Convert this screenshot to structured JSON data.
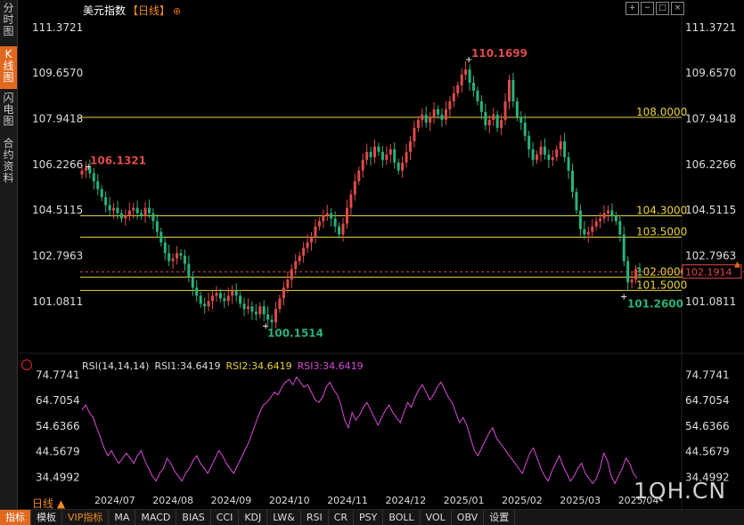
{
  "sidebar": {
    "tabs": [
      {
        "label": "分时图",
        "active": false
      },
      {
        "label": "K线图",
        "active": true
      },
      {
        "label": "闪电图",
        "active": false
      },
      {
        "label": "合约资料",
        "active": false
      }
    ]
  },
  "header": {
    "instrument": "美元指数",
    "period": "【日线】",
    "settings_icon": "gear-icon"
  },
  "toolbar_icons": [
    "zoom-in-icon",
    "zoom-out-icon",
    "maximize-icon",
    "close-icon"
  ],
  "period_label": "日线 ▲",
  "watermark": "1QH.CN",
  "colors": {
    "up": "#e04a4a",
    "down": "#29b27a",
    "level": "#e8d23a",
    "rsi": "#d94ad9",
    "current_price_tag": "#e04a4a",
    "accent": "#e2681f"
  },
  "rsi_legend": {
    "params": "RSI(14,14,14)",
    "rsi1": "RSI1:34.6419",
    "rsi2": "RSI2:34.6419",
    "rsi3": "RSI3:34.6419"
  },
  "bottom_tabs": [
    {
      "label": "指标",
      "active": true
    },
    {
      "label": "模板"
    },
    {
      "label": "VIP指标",
      "vip": true
    },
    {
      "label": "MA"
    },
    {
      "label": "MACD"
    },
    {
      "label": "BIAS"
    },
    {
      "label": "CCI"
    },
    {
      "label": "KDJ"
    },
    {
      "label": "LW&"
    },
    {
      "label": "RSI"
    },
    {
      "label": "CR"
    },
    {
      "label": "PSY"
    },
    {
      "label": "BOLL"
    },
    {
      "label": "VOL"
    },
    {
      "label": "OBV"
    },
    {
      "label": "设置"
    }
  ],
  "chart_data": [
    {
      "type": "candlestick",
      "x_labels": [
        "2024/07",
        "2024/08",
        "2024/09",
        "2024/10",
        "2024/11",
        "2024/12",
        "2025/01",
        "2025/02",
        "2025/03",
        "2025/04"
      ],
      "y_ticks": [
        "111.3721",
        "109.6570",
        "107.9418",
        "106.2266",
        "104.5115",
        "102.7963",
        "101.0811"
      ],
      "ylim": [
        99.54,
        111.87
      ],
      "horizontal_levels": [
        {
          "value": 108.0,
          "label": "108.0000"
        },
        {
          "value": 104.3,
          "label": "104.3000"
        },
        {
          "value": 103.5,
          "label": "103.5000"
        },
        {
          "value": 102.0,
          "label": "102.0000"
        },
        {
          "value": 101.5,
          "label": "101.5000"
        }
      ],
      "current_price": {
        "value": 102.1914,
        "label": "102.1914"
      },
      "annotations": [
        {
          "label": "106.1321",
          "value": 106.1321,
          "kind": "high"
        },
        {
          "label": "110.1699",
          "value": 110.1699,
          "kind": "high"
        },
        {
          "label": "100.1514",
          "value": 100.1514,
          "kind": "low"
        },
        {
          "label": "101.2600",
          "value": 101.26,
          "kind": "low"
        }
      ],
      "close_path": [
        106.0,
        106.1,
        105.9,
        105.6,
        105.3,
        105.0,
        104.7,
        104.5,
        104.6,
        104.4,
        104.2,
        104.3,
        104.5,
        104.6,
        104.4,
        104.3,
        104.6,
        104.4,
        104.1,
        103.7,
        103.3,
        102.9,
        102.6,
        102.7,
        102.9,
        102.8,
        102.5,
        102.0,
        101.6,
        101.3,
        101.0,
        100.9,
        101.1,
        101.3,
        101.4,
        101.2,
        101.1,
        101.3,
        101.5,
        101.3,
        101.0,
        100.8,
        100.9,
        100.7,
        100.6,
        100.9,
        100.6,
        100.4,
        100.3,
        100.8,
        101.2,
        101.6,
        101.9,
        102.3,
        102.6,
        102.8,
        103.1,
        103.3,
        103.5,
        103.9,
        104.1,
        104.3,
        104.4,
        104.2,
        103.9,
        103.6,
        104.0,
        104.6,
        105.1,
        105.6,
        106.0,
        106.4,
        106.7,
        106.5,
        106.9,
        106.7,
        106.4,
        106.6,
        106.8,
        106.3,
        106.0,
        106.3,
        106.7,
        107.1,
        107.6,
        107.9,
        108.1,
        107.8,
        108.0,
        108.3,
        108.1,
        107.9,
        108.3,
        108.6,
        108.9,
        109.2,
        109.6,
        109.8,
        109.3,
        109.0,
        108.6,
        108.2,
        107.7,
        107.9,
        108.1,
        107.6,
        107.9,
        108.6,
        109.4,
        108.6,
        108.0,
        107.8,
        107.3,
        106.8,
        106.4,
        106.6,
        106.9,
        106.6,
        106.4,
        106.5,
        106.8,
        107.1,
        106.5,
        106.0,
        105.2,
        104.5,
        103.8,
        103.6,
        103.7,
        103.9,
        104.1,
        104.2,
        104.4,
        104.5,
        104.3,
        104.1,
        103.6,
        102.6,
        101.8,
        101.9,
        102.3,
        102.2
      ],
      "title": ""
    },
    {
      "type": "line",
      "name": "RSI",
      "y_ticks": [
        "74.7741",
        "64.7054",
        "54.6366",
        "44.5679",
        "34.4992"
      ],
      "ylim": [
        29.0,
        76.0
      ],
      "values": [
        61,
        63,
        60,
        58,
        54,
        50,
        46,
        43,
        45,
        42,
        40,
        42,
        44,
        42,
        40,
        43,
        45,
        41,
        38,
        35,
        33,
        36,
        38,
        42,
        40,
        37,
        35,
        33,
        36,
        38,
        41,
        43,
        40,
        38,
        36,
        39,
        42,
        45,
        43,
        40,
        38,
        36,
        39,
        42,
        45,
        48,
        52,
        56,
        60,
        63,
        64,
        66,
        68,
        67,
        70,
        72,
        73,
        71,
        74,
        72,
        70,
        71,
        68,
        65,
        64,
        66,
        70,
        72,
        69,
        67,
        63,
        57,
        54,
        60,
        57,
        59,
        62,
        64,
        61,
        58,
        55,
        58,
        61,
        63,
        60,
        58,
        56,
        60,
        64,
        62,
        66,
        69,
        71,
        68,
        65,
        67,
        70,
        72,
        69,
        66,
        64,
        60,
        56,
        58,
        55,
        50,
        45,
        43,
        46,
        49,
        52,
        54,
        50,
        48,
        46,
        44,
        42,
        40,
        38,
        36,
        40,
        44,
        46,
        42,
        38,
        35,
        33,
        37,
        40,
        43,
        39,
        36,
        33,
        35,
        38,
        40,
        36,
        34,
        32,
        34,
        38,
        44,
        41,
        35,
        32,
        35,
        38,
        42,
        40,
        36,
        34
      ]
    }
  ]
}
